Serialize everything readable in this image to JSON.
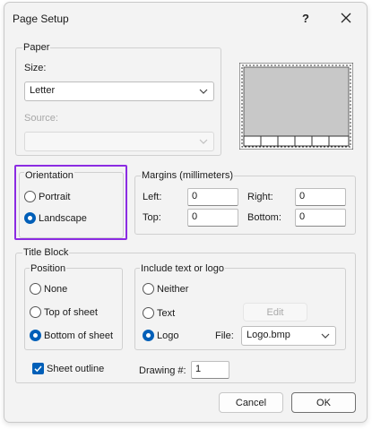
{
  "dialog": {
    "title": "Page Setup",
    "help_glyph": "?",
    "close_glyph": "✕"
  },
  "paper": {
    "group_label": "Paper",
    "size_label": "Size:",
    "size_value": "Letter",
    "source_label": "Source:",
    "source_value": ""
  },
  "orientation": {
    "group_label": "Orientation",
    "portrait_label": "Portrait",
    "landscape_label": "Landscape",
    "selected": "Landscape",
    "highlight_color": "#8b2be2"
  },
  "margins": {
    "group_label": "Margins (millimeters)",
    "left_label": "Left:",
    "left_value": "0",
    "right_label": "Right:",
    "right_value": "0",
    "top_label": "Top:",
    "top_value": "0",
    "bottom_label": "Bottom:",
    "bottom_value": "0"
  },
  "title_block": {
    "group_label": "Title Block",
    "position": {
      "group_label": "Position",
      "none_label": "None",
      "top_label": "Top of sheet",
      "bottom_label": "Bottom of sheet",
      "selected": "Bottom of sheet"
    },
    "include": {
      "group_label": "Include text or logo",
      "neither_label": "Neither",
      "text_label": "Text",
      "logo_label": "Logo",
      "selected": "Logo",
      "edit_label": "Edit",
      "file_label": "File:",
      "file_value": "Logo.bmp"
    },
    "sheet_outline_label": "Sheet outline",
    "sheet_outline_checked": true,
    "drawing_label": "Drawing #:",
    "drawing_value": "1"
  },
  "buttons": {
    "cancel_label": "Cancel",
    "ok_label": "OK"
  },
  "colors": {
    "accent": "#005fb8",
    "dialog_bg": "#f3f3f3",
    "preview_gray": "#c8c8c8"
  }
}
